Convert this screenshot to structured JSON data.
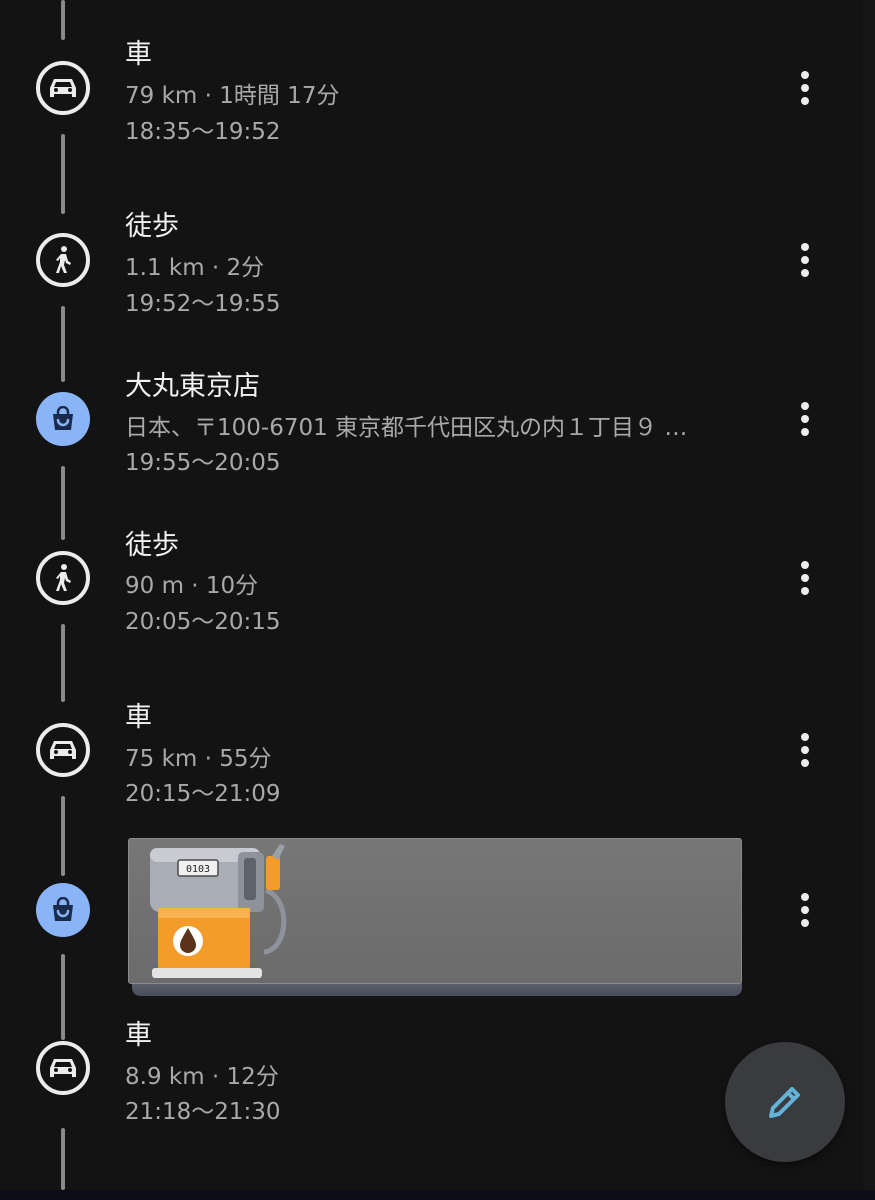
{
  "timeline": [
    {
      "type": "drive",
      "icon": "car-icon",
      "title": "車",
      "detail": "79 km · 1時間 17分",
      "time": "18:35〜19:52"
    },
    {
      "type": "walk",
      "icon": "walking-icon",
      "title": "徒歩",
      "detail": "1.1 km · 2分",
      "time": "19:52〜19:55"
    },
    {
      "type": "place",
      "icon": "shopping-bag-icon",
      "title": "大丸東京店",
      "detail": "日本、〒100-6701 東京都千代田区丸の内１丁目９ …",
      "time": "19:55〜20:05"
    },
    {
      "type": "walk",
      "icon": "walking-icon",
      "title": "徒歩",
      "detail": "90 m · 10分",
      "time": "20:05〜20:15"
    },
    {
      "type": "drive",
      "icon": "car-icon",
      "title": "車",
      "detail": "75 km · 55分",
      "time": "20:15〜21:09"
    },
    {
      "type": "place",
      "icon": "shopping-bag-icon",
      "title": "",
      "detail": "",
      "time": ""
    },
    {
      "type": "drive",
      "icon": "car-icon",
      "title": "車",
      "detail": "8.9 km · 12分",
      "time": "21:18〜21:30"
    }
  ],
  "overlay": {
    "icon": "gas-pump-icon",
    "counter": "0103"
  },
  "fab": {
    "icon": "pencil-icon"
  },
  "colors": {
    "background": "#131313",
    "place_accent": "#8ab4f8",
    "fab_background": "#3a3b3e",
    "fab_icon": "#63b3d8"
  }
}
